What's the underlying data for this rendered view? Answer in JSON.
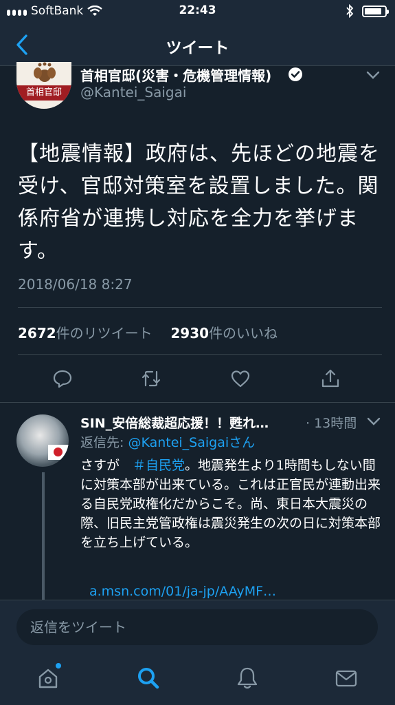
{
  "status_bar": {
    "carrier": "SoftBank",
    "time": "22:43"
  },
  "nav": {
    "title": "ツイート"
  },
  "tweet": {
    "author_name": "首相官邸(災害・危機管理情報)",
    "author_handle": "@Kantei_Saigai",
    "avatar_text": "首相官邸",
    "text": "【地震情報】政府は、先ほどの地震を受け、官邸対策室を設置しました。関係府省が連携し対応を全力を挙げます。",
    "timestamp": "2018/06/18 8:27",
    "retweet_count": "2672",
    "retweet_label": "件のリツイート",
    "like_count": "2930",
    "like_label": "件のいいね"
  },
  "reply": {
    "author_name": "SIN_安倍総裁超応援！！甦れ…",
    "time": "· 13時間",
    "reply_to_prefix": "返信先: ",
    "reply_to_handle": "@Kantei_Saigai",
    "reply_to_suffix": "さん",
    "text_before_tag": "さすが　",
    "hashtag": "＃自民党",
    "text_after_tag": "。地震発生より1時間もしない間に対策本部が出来ている。これは正官民が連動出来る自民党政権化だからこそ。尚、東日本大震災の際、旧民主党管政権は震災発生の次の日に対策本部を立ち上げている。",
    "link": "a.msn.com/01/ja-jp/AAyMF…"
  },
  "composer": {
    "placeholder": "返信をツイート"
  },
  "tabs": [
    "home-icon",
    "search-icon",
    "notifications-icon",
    "messages-icon"
  ],
  "colors": {
    "background": "#15202b",
    "bar": "#1c2938",
    "accent": "#1da1f2",
    "secondary_text": "#8899a6"
  }
}
